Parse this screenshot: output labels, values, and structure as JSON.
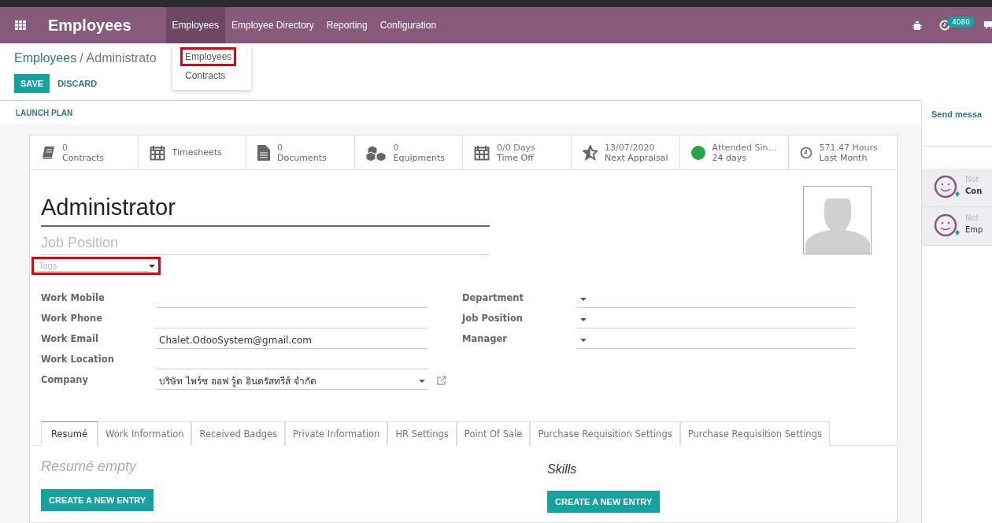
{
  "navbar": {
    "app_title": "Employees",
    "menu": [
      {
        "label": "Employees",
        "selected": true
      },
      {
        "label": "Employee Directory",
        "selected": false
      },
      {
        "label": "Reporting",
        "selected": false
      },
      {
        "label": "Configuration",
        "selected": false
      }
    ],
    "activity_badge": "4080"
  },
  "dropdown": [
    {
      "label": "Employees",
      "highlighted": true
    },
    {
      "label": "Contracts",
      "highlighted": false
    }
  ],
  "breadcrumb": {
    "parent": "Employees",
    "separator": "/",
    "current": "Administrato"
  },
  "buttons": {
    "save": "SAVE",
    "discard": "DISCARD"
  },
  "status_bar": {
    "action": "LAUNCH PLAN"
  },
  "stat_buttons": [
    {
      "kind": "book",
      "lines": [
        "0",
        "Contracts"
      ]
    },
    {
      "kind": "calendar",
      "lines": [
        "Timesheets"
      ]
    },
    {
      "kind": "file",
      "lines": [
        "0",
        "Documents"
      ]
    },
    {
      "kind": "cubes",
      "lines": [
        "0",
        "Equipments"
      ]
    },
    {
      "kind": "calendar",
      "lines": [
        "0/0 Days",
        "Time Off"
      ]
    },
    {
      "kind": "star",
      "lines": [
        "13/07/2020",
        "Next Appraisal"
      ]
    },
    {
      "kind": "dot",
      "color": "#28a745",
      "lines": [
        "Attended Sin…",
        "24 days"
      ]
    },
    {
      "kind": "clock",
      "lines": [
        "571.47 Hours",
        "Last Month"
      ]
    }
  ],
  "employee": {
    "name": "Administrator",
    "job_position": {
      "placeholder": "Job Position"
    },
    "tags": {
      "placeholder": "Tags",
      "highlighted": true
    }
  },
  "fields_left": [
    {
      "label": "Work Mobile",
      "kind": "text"
    },
    {
      "label": "Work Phone",
      "kind": "text"
    },
    {
      "label": "Work Email",
      "kind": "text",
      "value": "Chalet.OdooSystem@gmail.com"
    },
    {
      "label": "Work Location",
      "kind": "text"
    },
    {
      "label": "Company",
      "kind": "link-select",
      "value": "บริษัท ไพร์ซ ออฟ วู้ด อินดรัสทรีส์ จำกัด"
    }
  ],
  "fields_right": [
    {
      "label": "Department",
      "kind": "select"
    },
    {
      "label": "Job Position",
      "kind": "select"
    },
    {
      "label": "Manager",
      "kind": "select"
    }
  ],
  "tabs": [
    {
      "label": "Resumé",
      "selected": true
    },
    {
      "label": "Work Information",
      "selected": false
    },
    {
      "label": "Received Badges",
      "selected": false
    },
    {
      "label": "Private Information",
      "selected": false
    },
    {
      "label": "HR Settings",
      "selected": false
    },
    {
      "label": "Point Of Sale",
      "selected": false
    },
    {
      "label": "Purchase Requisition Settings",
      "selected": false
    },
    {
      "label": "Purchase Requisition Settings",
      "selected": false
    }
  ],
  "resume": {
    "empty_text": "Resumé empty",
    "button": "CREATE A NEW ENTRY"
  },
  "skills": {
    "title": "Skills",
    "button": "CREATE A NEW ENTRY"
  },
  "chatter": {
    "send_message": "Send messa",
    "messages": [
      {
        "line1": "Not",
        "line2": "Con",
        "bold": true
      },
      {
        "line1": "Not",
        "line2": "Emp",
        "bold": false
      }
    ]
  }
}
